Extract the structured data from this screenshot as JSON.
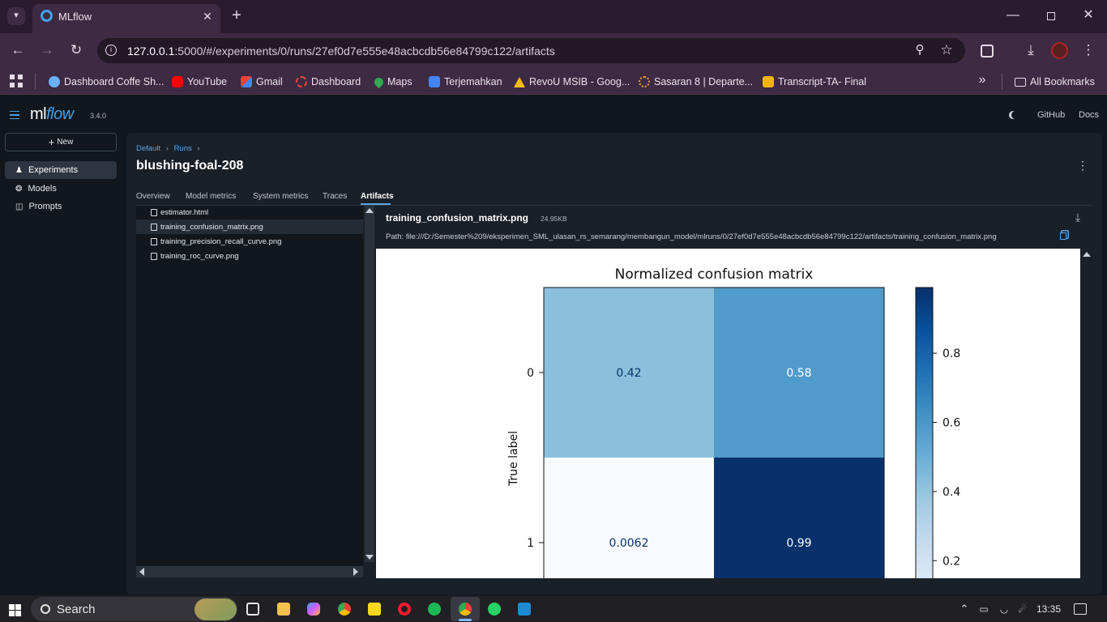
{
  "browser": {
    "tab_title": "MLflow",
    "url_host": "127.0.0.1",
    "url_rest": ":5000/#/experiments/0/runs/27ef0d7e555e48acbcdb56e84799c122/artifacts",
    "bookmarks": [
      {
        "label": "Dashboard Coffe Sh...",
        "icon": "dashboard-coffee-icon",
        "color": "#6ab0ff"
      },
      {
        "label": "YouTube",
        "icon": "youtube-icon",
        "color": "#ff0000"
      },
      {
        "label": "Gmail",
        "icon": "gmail-icon",
        "color": "#ea4335"
      },
      {
        "label": "Dashboard",
        "icon": "dashboard-icon",
        "color": "#e94235"
      },
      {
        "label": "Maps",
        "icon": "maps-icon",
        "color": "#34a853"
      },
      {
        "label": "Terjemahkan",
        "icon": "translate-icon",
        "color": "#4285f4"
      },
      {
        "label": "RevoU MSIB - Goog...",
        "icon": "google-drive-icon",
        "color": "#fbbc04"
      },
      {
        "label": "Sasaran 8 | Departe...",
        "icon": "sasaran-icon",
        "color": "#e5a13b"
      },
      {
        "label": "Transcript-TA- Final",
        "icon": "slides-icon",
        "color": "#f4b400"
      }
    ],
    "all_bookmarks": "All Bookmarks"
  },
  "app": {
    "logo_ml": "ml",
    "logo_flow": "flow",
    "version": "3.4.0",
    "github": "GitHub",
    "docs": "Docs",
    "new_button": "New",
    "nav": [
      {
        "label": "Experiments",
        "icon": "experiments-icon"
      },
      {
        "label": "Models",
        "icon": "models-icon"
      },
      {
        "label": "Prompts",
        "icon": "prompts-icon"
      }
    ],
    "breadcrumb": {
      "level1": "Default",
      "level2": "Runs"
    },
    "run_name": "blushing-foal-208",
    "tabs": [
      "Overview",
      "Model metrics",
      "System metrics",
      "Traces",
      "Artifacts"
    ],
    "active_tab": "Artifacts",
    "files": [
      "estimator.html",
      "training_confusion_matrix.png",
      "training_precision_recall_curve.png",
      "training_roc_curve.png"
    ],
    "selected_file": "training_confusion_matrix.png",
    "preview": {
      "file_name": "training_confusion_matrix.png",
      "file_size": "24.95KB",
      "path": "Path: file:///D:/Semester%209/eksperimen_SML_ulasan_rs_semarang/membangun_model/mlruns/0/27ef0d7e555e48acbcdb56e84799c122/artifacts/training_confusion_matrix.png"
    }
  },
  "chart_data": {
    "type": "heatmap",
    "title": "Normalized confusion matrix",
    "ylabel": "True label",
    "rows": [
      "0",
      "1"
    ],
    "matrix": [
      [
        0.42,
        0.58
      ],
      [
        0.0062,
        0.99
      ]
    ],
    "cell_labels": [
      [
        "0.42",
        "0.58"
      ],
      [
        "0.0062",
        "0.99"
      ]
    ],
    "colorscale": "Blues",
    "colorbar_ticks": [
      "0.8",
      "0.6",
      "0.4",
      "0.2"
    ],
    "colorbar_tick_values": [
      0.8,
      0.6,
      0.4,
      0.2
    ]
  },
  "taskbar": {
    "search": "Search",
    "time": "13:35"
  }
}
